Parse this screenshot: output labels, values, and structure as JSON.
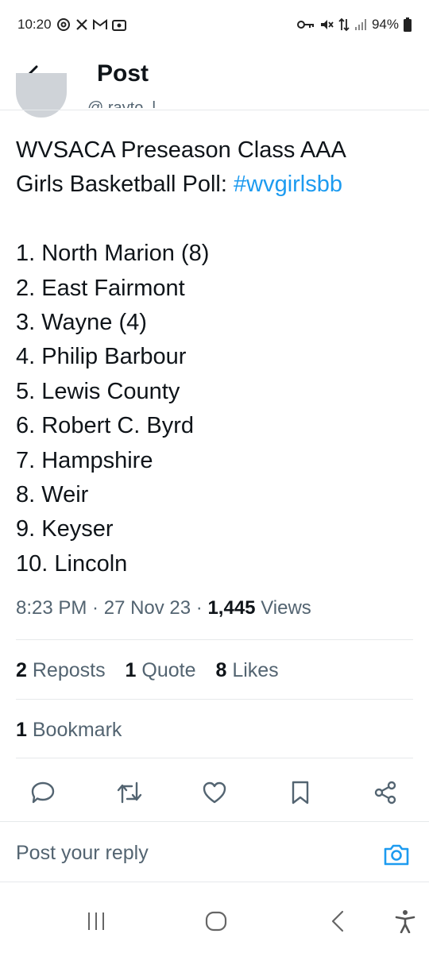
{
  "status_bar": {
    "time": "10:20",
    "battery": "94%",
    "icons_left": [
      "threads-icon",
      "x-icon",
      "gmail-icon",
      "gallery-icon"
    ],
    "icons_right": [
      "vpn-key-icon",
      "mute-icon",
      "data-icon",
      "signal-icon",
      "battery-icon"
    ]
  },
  "header": {
    "title": "Post"
  },
  "author": {
    "handle_partial": "@ rayto_l..."
  },
  "post": {
    "text_main": "WVSACA Preseason Class AAA\nGirls Basketball Poll: ",
    "hashtag": "#wvgirlsbb",
    "ranking": [
      "1. North Marion (8)",
      "2. East Fairmont",
      "3. Wayne (4)",
      "4. Philip Barbour",
      "5. Lewis County",
      "6. Robert C. Byrd",
      "7. Hampshire",
      "8. Weir",
      "9. Keyser",
      "10. Lincoln"
    ],
    "time": "8:23 PM",
    "date": "27 Nov 23",
    "views_count": "1,445",
    "views_label": "Views"
  },
  "stats": {
    "reposts_count": "2",
    "reposts_label": "Reposts",
    "quotes_count": "1",
    "quotes_label": "Quote",
    "likes_count": "8",
    "likes_label": "Likes",
    "bookmarks_count": "1",
    "bookmarks_label": "Bookmark"
  },
  "reply": {
    "placeholder": "Post your reply"
  },
  "colors": {
    "accent": "#1d9bf0",
    "text": "#0f1419",
    "secondary": "#536471",
    "divider": "#e6e9eb"
  }
}
